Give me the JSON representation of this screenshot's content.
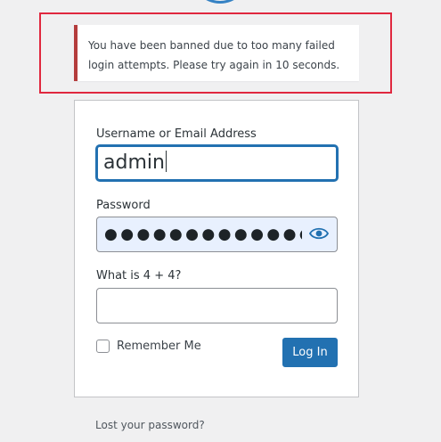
{
  "notice": {
    "line1": "You have been banned due to too many failed",
    "line2": "login attempts. Please try again in 10 seconds."
  },
  "form": {
    "username_label": "Username or Email Address",
    "username_value": "admin",
    "password_label": "Password",
    "password_mask": "●●●●●●●●●●●●●●●●",
    "question_label": "What is 4 + 4?",
    "question_value": "",
    "remember_label": "Remember Me",
    "login_label": "Log In"
  },
  "links": {
    "lost_password": "Lost your password?"
  },
  "colors": {
    "accent": "#2271b1",
    "error_border": "#b43c3c",
    "highlight": "#e0283f",
    "autofill_bg": "#e8f0fe"
  }
}
